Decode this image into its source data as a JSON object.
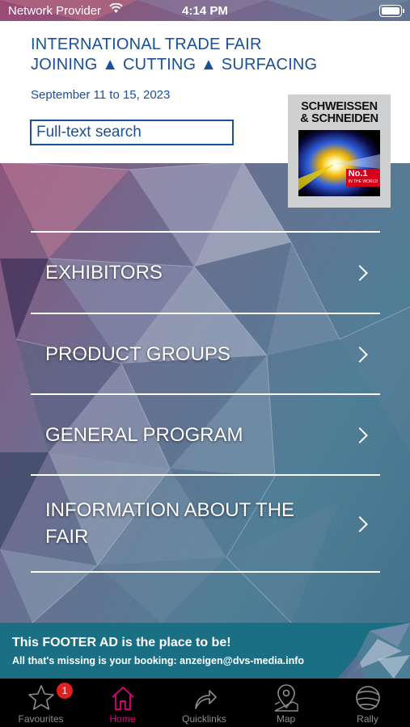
{
  "status_bar": {
    "carrier": "Network Provider",
    "time": "4:14 PM"
  },
  "header": {
    "line1": "INTERNATIONAL TRADE FAIR",
    "line2": "JOINING ▲ CUTTING ▲ SURFACING",
    "date": "September 11 to 15, 2023",
    "search_placeholder": "Full-text search"
  },
  "logo": {
    "line1": "SCHWEISSEN",
    "line2": "& SCHNEIDEN",
    "badge_big": "No.1",
    "badge_small": "IN THE WORLD"
  },
  "menu": [
    {
      "label": "EXHIBITORS"
    },
    {
      "label": "PRODUCT GROUPS"
    },
    {
      "label": "GENERAL PROGRAM"
    },
    {
      "label": "INFORMATION ABOUT THE FAIR"
    }
  ],
  "footer_ad": {
    "headline": "This FOOTER AD is the place to be!",
    "subline": "All that's missing is your booking: anzeigen@dvs-media.info"
  },
  "tabs": [
    {
      "label": "Favourites",
      "icon": "star-icon",
      "badge": "1"
    },
    {
      "label": "Home",
      "icon": "home-icon",
      "active": true
    },
    {
      "label": "Quicklinks",
      "icon": "share-arrow-icon"
    },
    {
      "label": "Map",
      "icon": "map-pin-icon"
    },
    {
      "label": "Rally",
      "icon": "globe-icon"
    }
  ],
  "colors": {
    "brand_blue": "#1a4f9a",
    "active_tab": "#e6007e",
    "inactive_tab": "#8e8e93",
    "footer_ad_bg": "#1b6f84",
    "badge_red": "#e02020"
  }
}
